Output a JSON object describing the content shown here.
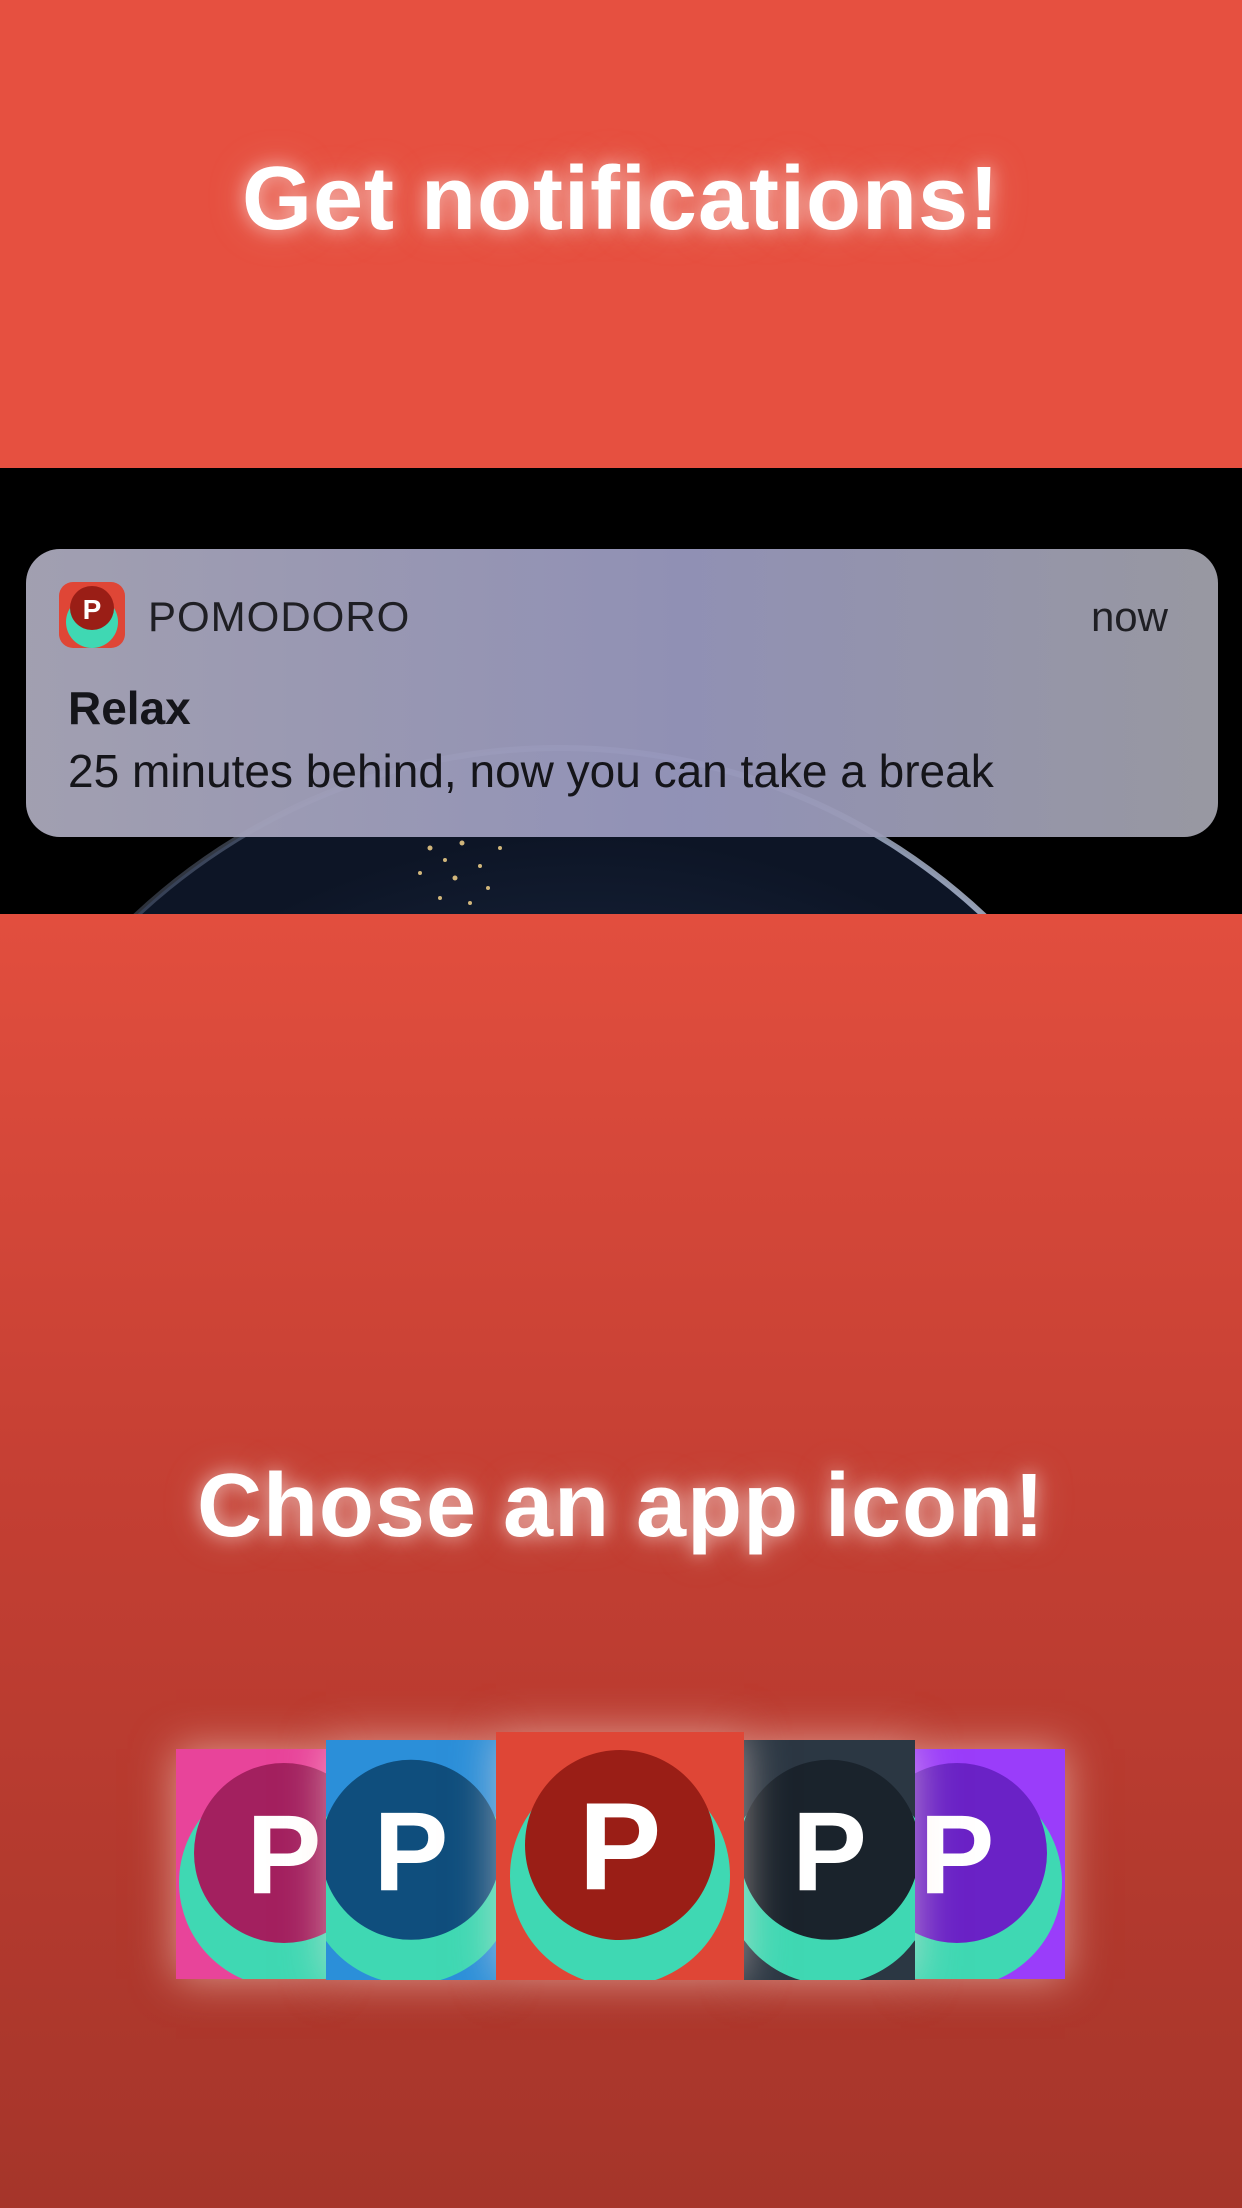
{
  "screen": {
    "headline_top": "Get notifications!",
    "headline_bottom": "Chose an app icon!"
  },
  "notification": {
    "app_name": "POMODORO",
    "time": "now",
    "title": "Relax",
    "body": "25 minutes behind, now you can take a break",
    "app_icon": "pomodoro-app-icon"
  },
  "app_icons": [
    {
      "name": "pink",
      "letter": "P",
      "bg": "#e8449a",
      "dome": "#a3205f"
    },
    {
      "name": "blue",
      "letter": "P",
      "bg": "#2b8fd9",
      "dome": "#0f4e7d"
    },
    {
      "name": "red",
      "letter": "P",
      "bg": "#df4636",
      "dome": "#9a1e16",
      "selected": true
    },
    {
      "name": "dark",
      "letter": "P",
      "bg": "#2b3743",
      "dome": "#1a232c"
    },
    {
      "name": "purple",
      "letter": "P",
      "bg": "#9a3dfa",
      "dome": "#6a22c6"
    }
  ],
  "colors": {
    "brand_red": "#e65040",
    "mint": "#3fd8b3",
    "text_white": "#ffffff"
  }
}
